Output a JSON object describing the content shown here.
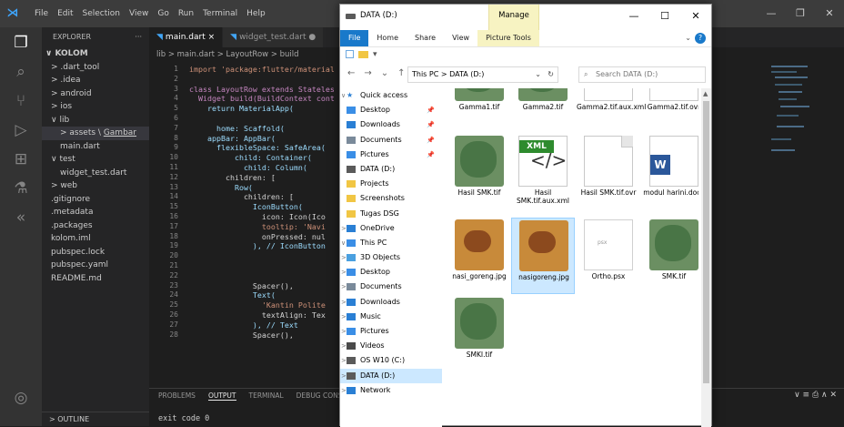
{
  "vscode": {
    "menu": [
      "File",
      "Edit",
      "Selection",
      "View",
      "Go",
      "Run",
      "Terminal",
      "Help"
    ],
    "explorer_header": "EXPLORER",
    "explorer_more": "···",
    "project": "KOLOM",
    "tree": [
      {
        "label": "> .dart_tool",
        "indent": 1
      },
      {
        "label": "> .idea",
        "indent": 1
      },
      {
        "label": "> android",
        "indent": 1
      },
      {
        "label": "> ios",
        "indent": 1
      },
      {
        "label": "∨ lib",
        "indent": 1
      },
      {
        "label": "> assets \\ ",
        "extra": "Gambar",
        "indent": 2,
        "selected": true
      },
      {
        "label": "main.dart",
        "indent": 2
      },
      {
        "label": "∨ test",
        "indent": 1
      },
      {
        "label": "widget_test.dart",
        "indent": 2
      },
      {
        "label": "> web",
        "indent": 1
      },
      {
        "label": ".gitignore",
        "indent": 1
      },
      {
        "label": ".metadata",
        "indent": 1
      },
      {
        "label": ".packages",
        "indent": 1
      },
      {
        "label": "kolom.iml",
        "indent": 1
      },
      {
        "label": "pubspec.lock",
        "indent": 1
      },
      {
        "label": "pubspec.yaml",
        "indent": 1
      },
      {
        "label": "README.md",
        "indent": 1
      }
    ],
    "outline": "> OUTLINE",
    "tabs": [
      {
        "label": "main.dart",
        "close": "×",
        "active": true
      },
      {
        "label": "widget_test.dart",
        "close": "●",
        "active": false
      }
    ],
    "breadcrumb": "lib > main.dart > LayoutRow > build",
    "line_numbers": [
      "1",
      "2",
      "3",
      "4",
      "5",
      "6",
      "7",
      "8",
      "9",
      "10",
      "11",
      "12",
      "13",
      "14",
      "15",
      "16",
      "17",
      "18",
      "19",
      "20",
      "21",
      "22",
      "23",
      "24",
      "25",
      "26",
      "27",
      "28"
    ],
    "code_lines": [
      "import 'package:flutter/material",
      "",
      "class LayoutRow extends Stateles",
      "  Widget build(BuildContext cont",
      "    return MaterialApp(",
      "",
      "      home: Scaffold(",
      "    appBar: AppBar(",
      "      flexibleSpace: SafeArea(",
      "          child: Container(",
      "            child: Column(",
      "        children: [",
      "          Row(",
      "            children: [",
      "              IconButton(",
      "                icon: Icon(Ico",
      "                tooltip: 'Navi",
      "                onPressed: nul",
      "              ), // IconButton",
      "",
      "",
      "",
      "              Spacer(),",
      "              Text(",
      "                'Kantin Polite",
      "                textAlign: Tex",
      "              ), // Text",
      "              Spacer(),"
    ],
    "panel_tabs": [
      "PROBLEMS",
      "OUTPUT",
      "TERMINAL",
      "DEBUG CONSO"
    ],
    "panel_output": "exit code 0"
  },
  "explorer": {
    "title": "DATA (D:)",
    "manage": "Manage",
    "window_buttons": [
      "—",
      "☐",
      "✕"
    ],
    "ribbon": [
      "File",
      "Home",
      "Share",
      "View",
      "Picture Tools"
    ],
    "help": "?",
    "address": "This PC  >  DATA (D:)",
    "search_placeholder": "Search DATA (D:)",
    "nav": [
      {
        "label": "Quick access",
        "icon": "star",
        "pinned": false,
        "arrow": "∨"
      },
      {
        "label": "Desktop",
        "icon": "desktop",
        "pinned": true
      },
      {
        "label": "Downloads",
        "icon": "download",
        "pinned": true
      },
      {
        "label": "Documents",
        "icon": "document",
        "pinned": true
      },
      {
        "label": "Pictures",
        "icon": "picture",
        "pinned": true
      },
      {
        "label": "DATA (D:)",
        "icon": "drive"
      },
      {
        "label": "Projects",
        "icon": "folder"
      },
      {
        "label": "Screenshots",
        "icon": "folder"
      },
      {
        "label": "Tugas DSG",
        "icon": "folder"
      },
      {
        "label": "OneDrive",
        "icon": "cloud",
        "arrow": ">"
      },
      {
        "label": "This PC",
        "icon": "pc",
        "arrow": "∨"
      },
      {
        "label": "3D Objects",
        "icon": "cube",
        "arrow": ">"
      },
      {
        "label": "Desktop",
        "icon": "desktop",
        "arrow": ">"
      },
      {
        "label": "Documents",
        "icon": "document",
        "arrow": ">"
      },
      {
        "label": "Downloads",
        "icon": "download",
        "arrow": ">"
      },
      {
        "label": "Music",
        "icon": "music",
        "arrow": ">"
      },
      {
        "label": "Pictures",
        "icon": "picture",
        "arrow": ">"
      },
      {
        "label": "Videos",
        "icon": "video",
        "arrow": ">"
      },
      {
        "label": "OS W10 (C:)",
        "icon": "drive",
        "arrow": ">"
      },
      {
        "label": "DATA (D:)",
        "icon": "drive",
        "arrow": ">",
        "selected": true
      },
      {
        "label": "Network",
        "icon": "network",
        "arrow": ">"
      }
    ],
    "files": [
      {
        "name": "Gamma1.tif",
        "kind": "map"
      },
      {
        "name": "Gamma2.tif",
        "kind": "map"
      },
      {
        "name": "Gamma2.tif.aux.xml",
        "kind": "doc"
      },
      {
        "name": "Gamma2.tif.ovr",
        "kind": "doc"
      },
      {
        "name": "Hasil SMK.tif",
        "kind": "map"
      },
      {
        "name": "Hasil SMK.tif.aux.xml",
        "kind": "xml"
      },
      {
        "name": "Hasil SMK.tif.ovr",
        "kind": "doc"
      },
      {
        "name": "modul harini.docx",
        "kind": "word"
      },
      {
        "name": "nasi_goreng.jpg",
        "kind": "food"
      },
      {
        "name": "nasigoreng.jpg",
        "kind": "food",
        "selected": true
      },
      {
        "name": "Ortho.psx",
        "kind": "psx"
      },
      {
        "name": "SMK.tif",
        "kind": "map"
      },
      {
        "name": "SMKI.tif",
        "kind": "map"
      }
    ],
    "xml_badge": "XML",
    "word_badge": "W",
    "psx_badge": "psx"
  }
}
